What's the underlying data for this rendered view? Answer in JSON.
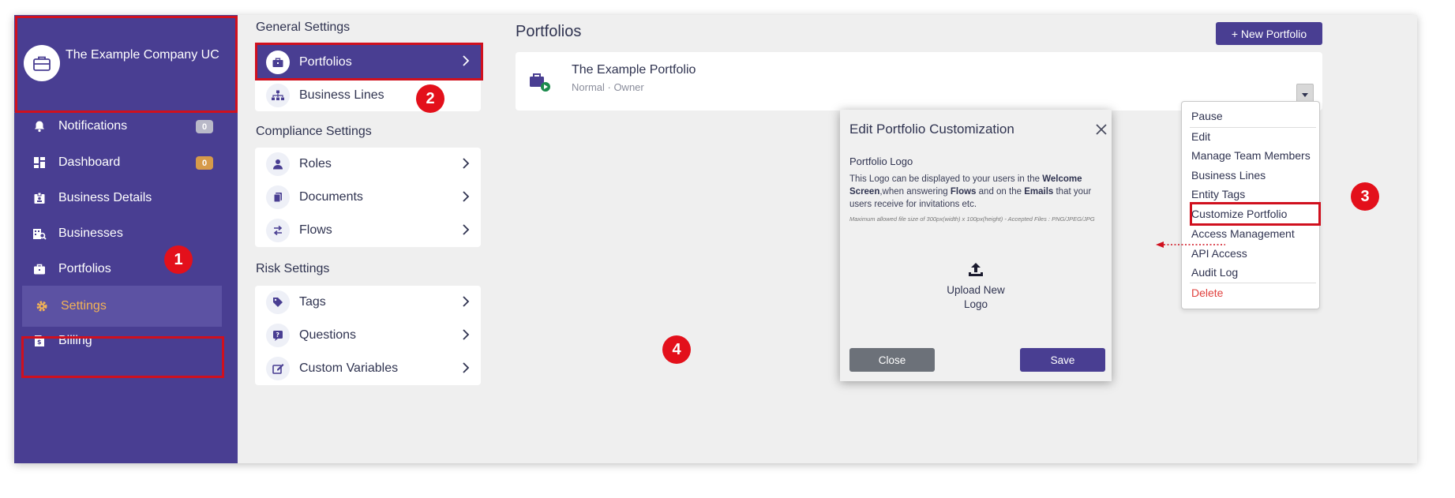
{
  "company": {
    "name": "The Example Company UC"
  },
  "sidebar": {
    "items": [
      {
        "label": "Notifications",
        "badge": "0",
        "badge_color": "#b9b9c8",
        "icon": "bell-icon"
      },
      {
        "label": "Dashboard",
        "badge": "0",
        "badge_color": "#d69a4a",
        "icon": "dashboard-icon"
      },
      {
        "label": "Business Details",
        "icon": "id-badge-icon"
      },
      {
        "label": "Businesses",
        "icon": "business-search-icon"
      },
      {
        "label": "Portfolios",
        "icon": "briefcase-icon"
      },
      {
        "label": "Settings",
        "icon": "gear-icon",
        "active": true
      },
      {
        "label": "Billing",
        "icon": "invoice-icon"
      }
    ]
  },
  "settings": {
    "general_title": "General Settings",
    "general": [
      {
        "label": "Portfolios",
        "active": true
      },
      {
        "label": "Business Lines"
      }
    ],
    "compliance_title": "Compliance Settings",
    "compliance": [
      {
        "label": "Roles"
      },
      {
        "label": "Documents"
      },
      {
        "label": "Flows"
      }
    ],
    "risk_title": "Risk Settings",
    "risk": [
      {
        "label": "Tags"
      },
      {
        "label": "Questions"
      },
      {
        "label": "Custom Variables"
      }
    ]
  },
  "main": {
    "title": "Portfolios",
    "new_button": "+ New Portfolio",
    "portfolio": {
      "name": "The Example Portfolio",
      "subtitle": "Normal · Owner"
    }
  },
  "menu": {
    "items": [
      "Pause",
      "Edit",
      "Manage Team Members",
      "Business Lines",
      "Entity Tags",
      "Customize Portfolio",
      "Access Management",
      "API Access",
      "Audit Log",
      "Delete"
    ],
    "danger_color": "#e0413e"
  },
  "modal": {
    "title": "Edit Portfolio Customization",
    "logo_label": "Portfolio Logo",
    "desc_1": "This Logo can be displayed to your users in the ",
    "desc_welcome": "Welcome Screen",
    "desc_2": ",when answering ",
    "desc_flows": "Flows",
    "desc_3": " and on the ",
    "desc_emails": "Emails",
    "desc_4": " that your users receive for invitations etc.",
    "note": "Maximum allowed file size of 300px(width) x 100px(height) - Accepted Files : PNG/JPEG/JPG",
    "upload_label": "Upload New Logo",
    "close_button": "Close",
    "save_button": "Save"
  },
  "callouts": [
    "1",
    "2",
    "3",
    "4"
  ],
  "colors": {
    "primary": "#493e92",
    "annotation": "#d0101e",
    "active_text": "#f2b256"
  }
}
